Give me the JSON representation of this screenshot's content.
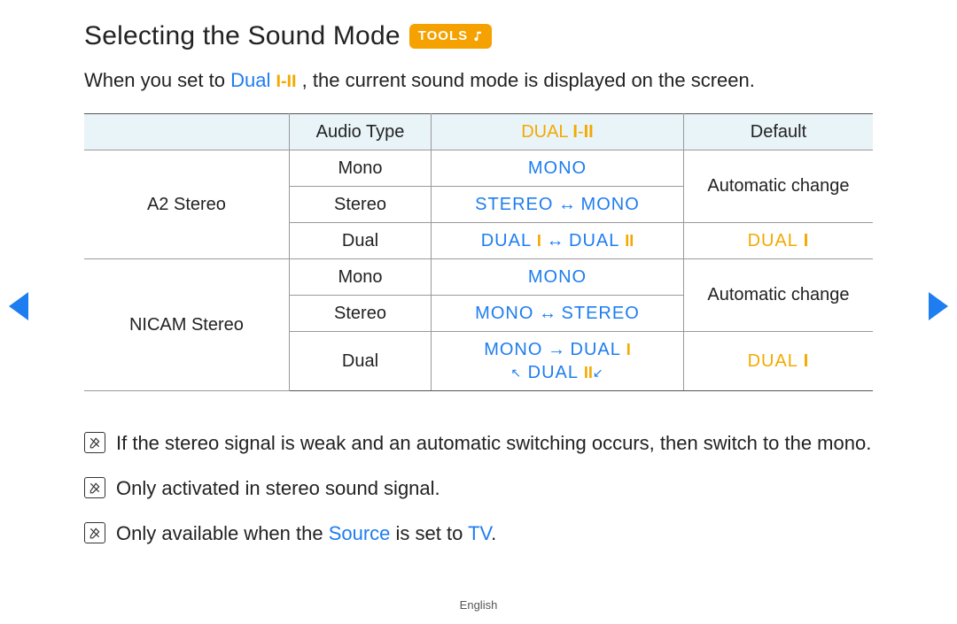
{
  "title": "Selecting the Sound Mode",
  "tools_badge": "TOOLS",
  "intro": {
    "prefix": "When you set to ",
    "dual_label": "Dual ",
    "roman1": "I",
    "dash": "-",
    "roman2": "II",
    "suffix": ", the current sound mode is displayed on the screen."
  },
  "table": {
    "headers": {
      "col1": "",
      "col2": "Audio Type",
      "col3_prefix": "DUAL ",
      "col3_r1": "I",
      "col3_dash": "-",
      "col3_r2": "II",
      "col4": "Default"
    },
    "a2_label": "A2 Stereo",
    "nicam_label": "NICAM Stereo",
    "rows": {
      "a2_mono": {
        "audio": "Mono",
        "dual": "MONO"
      },
      "a2_stereo": {
        "audio": "Stereo",
        "dual_left": "STEREO",
        "arr": " ↔ ",
        "dual_right": "MONO"
      },
      "a2_dual": {
        "audio": "Dual",
        "dual_left": "DUAL ",
        "r1": "I",
        "arr": " ↔ ",
        "dual_right": "DUAL ",
        "r2": "II",
        "default_left": "DUAL ",
        "default_r": "I"
      },
      "n_mono": {
        "audio": "Mono",
        "dual": "MONO"
      },
      "n_stereo": {
        "audio": "Stereo",
        "dual_left": "MONO",
        "arr": " ↔ ",
        "dual_right": "STEREO"
      },
      "n_dual": {
        "audio": "Dual",
        "line1_left": "MONO",
        "line1_arr": " → ",
        "line1_right": "DUAL ",
        "line1_r": "I",
        "line2_diagL": "↖",
        "line2_mid": " DUAL ",
        "line2_r": "II",
        "line2_diagR": " ↙",
        "default_left": "DUAL ",
        "default_r": "I"
      }
    },
    "auto_change": "Automatic change"
  },
  "notes": {
    "n1": "If the stereo signal is weak and an automatic switching occurs, then switch to the mono.",
    "n2": "Only activated in stereo sound signal.",
    "n3_prefix": "Only available when the ",
    "n3_source": "Source",
    "n3_mid": " is set to ",
    "n3_tv": "TV",
    "n3_suffix": "."
  },
  "footer_lang": "English"
}
